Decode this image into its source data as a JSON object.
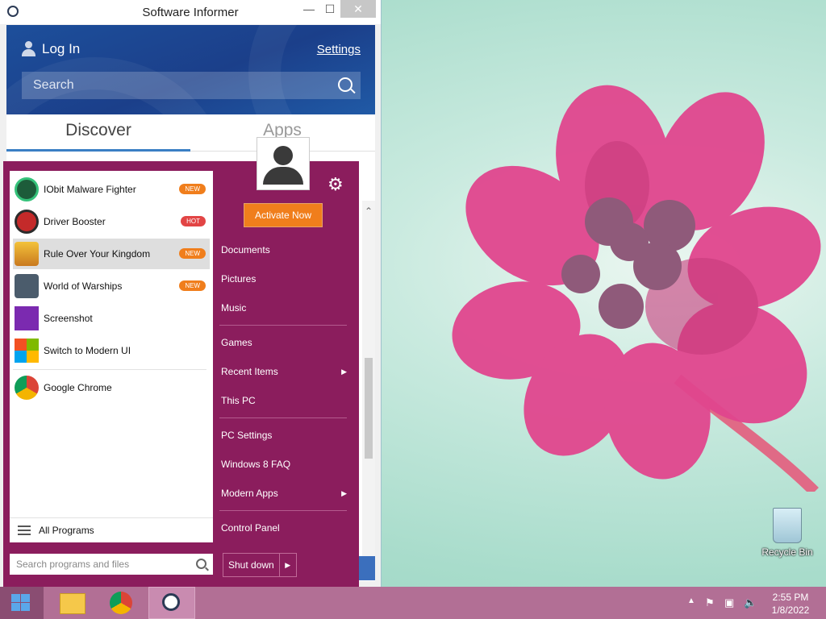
{
  "window": {
    "title": "Software Informer",
    "login_label": "Log In",
    "settings_label": "Settings",
    "search_placeholder": "Search",
    "tabs": [
      "Discover",
      "Apps"
    ]
  },
  "start_menu": {
    "programs": [
      {
        "name": "IObit Malware Fighter",
        "badge": "NEW",
        "icon": "iobit-icon"
      },
      {
        "name": "Driver Booster",
        "badge": "HOT",
        "icon": "driver-booster-icon"
      },
      {
        "name": "Rule Over Your Kingdom",
        "badge": "NEW",
        "icon": "crown-icon"
      },
      {
        "name": "World of Warships",
        "badge": "NEW",
        "icon": "warships-icon"
      },
      {
        "name": "Screenshot",
        "badge": "",
        "icon": "crop-icon"
      },
      {
        "name": "Switch to Modern UI",
        "badge": "",
        "icon": "modern-ui-icon"
      },
      {
        "name": "Google Chrome",
        "badge": "",
        "icon": "chrome-icon"
      }
    ],
    "all_programs": "All Programs",
    "search_placeholder": "Search programs and files",
    "activate": "Activate Now",
    "right_items": [
      {
        "label": "Documents"
      },
      {
        "label": "Pictures"
      },
      {
        "label": "Music"
      },
      {
        "label": "Games"
      },
      {
        "label": "Recent Items"
      },
      {
        "label": "This PC"
      },
      {
        "label": "PC Settings"
      },
      {
        "label": "Windows 8 FAQ"
      },
      {
        "label": "Modern Apps"
      },
      {
        "label": "Control Panel"
      }
    ],
    "shutdown": "Shut down"
  },
  "desktop": {
    "recycle_bin": "Recycle Bin"
  },
  "taskbar": {
    "time": "2:55 PM",
    "date": "1/8/2022"
  },
  "colors": {
    "start_menu_bg": "#8b1d5d",
    "taskbar_bg": "#b26f95",
    "accent_orange": "#f07e1c",
    "header_blue": "#1d4f9b"
  }
}
